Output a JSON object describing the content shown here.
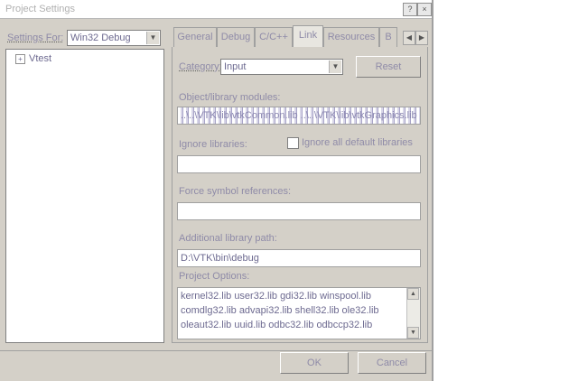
{
  "window": {
    "title": "Project Settings",
    "close_glyph": "×",
    "help_glyph": "?"
  },
  "settings_for": {
    "label": "Settings For:",
    "value": "Win32 Debug"
  },
  "tree": {
    "root": "Vtest",
    "expand_glyph": "+"
  },
  "tabs": [
    "General",
    "Debug",
    "C/C++",
    "Link",
    "Resources",
    "B"
  ],
  "active_tab": "Link",
  "tab_scroll": {
    "left": "◀",
    "right": "▶"
  },
  "category": {
    "label": "Category:",
    "value": "Input"
  },
  "reset_label": "Reset",
  "object_modules": {
    "label": "Object/library modules:",
    "value": "..\\..\\VTK\\lib\\vtkCommon.lib ..\\..\\VTK\\lib\\vtkGraphics.lib vtkImaging.lib"
  },
  "ignore_libraries": {
    "label": "Ignore libraries:",
    "value": ""
  },
  "ignore_default": {
    "label": "Ignore all default libraries",
    "checked": false
  },
  "force_symbol": {
    "label": "Force symbol references:",
    "value": ""
  },
  "additional_path": {
    "label": "Additional library path:",
    "value": "D:\\VTK\\bin\\debug"
  },
  "project_options": {
    "label": "Project Options:",
    "lines": [
      "kernel32.lib user32.lib gdi32.lib winspool.lib",
      "comdlg32.lib advapi32.lib shell32.lib ole32.lib",
      "oleaut32.lib uuid.lib odbc32.lib odbccp32.lib"
    ]
  },
  "footer": {
    "ok_label": "OK",
    "cancel_label": "Cancel"
  }
}
